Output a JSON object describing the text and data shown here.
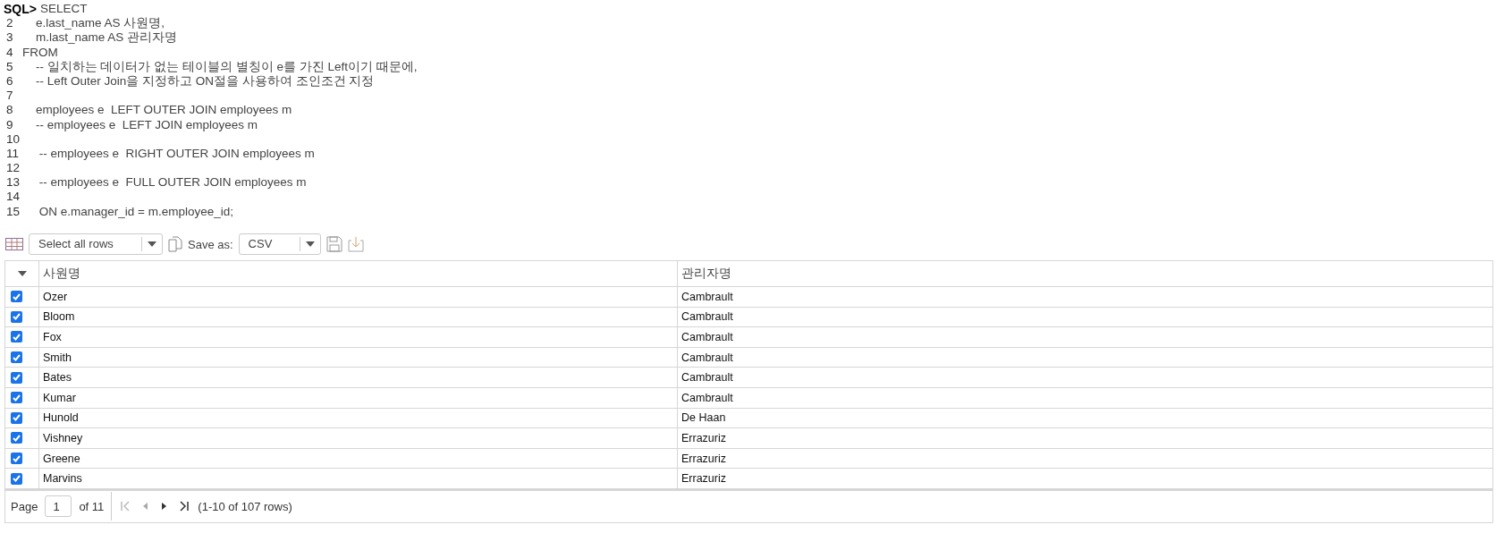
{
  "editor": {
    "prompt": "SQL>",
    "lines": [
      {
        "text": "SELECT"
      },
      {
        "number": "2",
        "text": "    e.last_name AS 사원명,"
      },
      {
        "number": "3",
        "text": "    m.last_name AS 관리자명"
      },
      {
        "number": "4",
        "text": "FROM"
      },
      {
        "number": "5",
        "text": "    -- 일치하는 데이터가 없는 테이블의 별칭이 e를 가진 Left이기 때문에,"
      },
      {
        "number": "6",
        "text": "    -- Left Outer Join을 지정하고 ON절을 사용하여 조인조건 지정"
      },
      {
        "number": "7"
      },
      {
        "number": "8",
        "text": "    employees e  LEFT OUTER JOIN employees m"
      },
      {
        "number": "9",
        "text": "    -- employees e  LEFT JOIN employees m"
      },
      {
        "number": "10"
      },
      {
        "number": "11",
        "text": "     -- employees e  RIGHT OUTER JOIN employees m"
      },
      {
        "number": "12"
      },
      {
        "number": "13",
        "text": "     -- employees e  FULL OUTER JOIN employees m"
      },
      {
        "number": "14"
      },
      {
        "number": "15",
        "text": "     ON e.manager_id = m.employee_id;"
      }
    ]
  },
  "toolbar": {
    "select": "Select all rows",
    "save_label": "Save as:",
    "format": "CSV"
  },
  "table": {
    "columns": [
      "사원명",
      "관리자명"
    ],
    "rows": [
      {
        "checked": true,
        "cells": [
          "Ozer",
          "Cambrault"
        ]
      },
      {
        "checked": true,
        "cells": [
          "Bloom",
          "Cambrault"
        ]
      },
      {
        "checked": true,
        "cells": [
          "Fox",
          "Cambrault"
        ]
      },
      {
        "checked": true,
        "cells": [
          "Smith",
          "Cambrault"
        ]
      },
      {
        "checked": true,
        "cells": [
          "Bates",
          "Cambrault"
        ]
      },
      {
        "checked": true,
        "cells": [
          "Kumar",
          "Cambrault"
        ]
      },
      {
        "checked": true,
        "cells": [
          "Hunold",
          "De Haan"
        ]
      },
      {
        "checked": true,
        "cells": [
          "Vishney",
          "Errazuriz"
        ]
      },
      {
        "checked": true,
        "cells": [
          "Greene",
          "Errazuriz"
        ]
      },
      {
        "checked": true,
        "cells": [
          "Marvins",
          "Errazuriz"
        ]
      }
    ]
  },
  "pager": {
    "page_label": "Page",
    "page": "1",
    "of": "of 11",
    "summary": "(1-10 of 107 rows)"
  }
}
